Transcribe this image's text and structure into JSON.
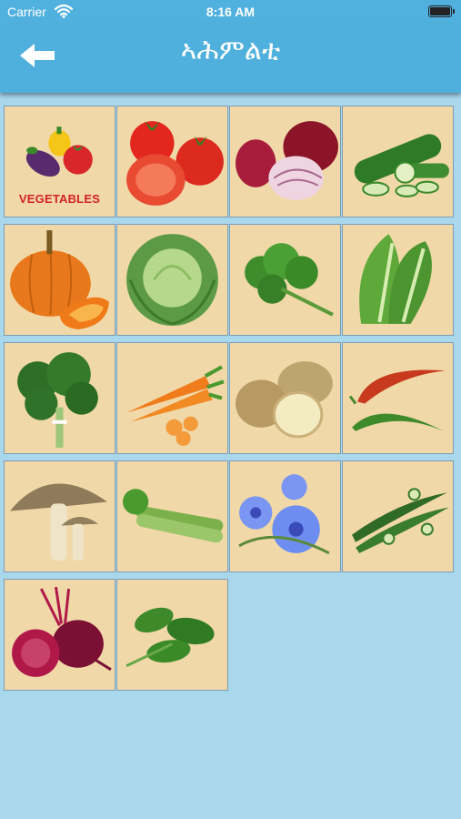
{
  "status_bar": {
    "carrier": "Carrier",
    "time": "8:16 AM"
  },
  "nav": {
    "title": "ኣሕምልቲ",
    "back_icon": "back-arrow-icon"
  },
  "grid": {
    "tiles": [
      {
        "name": "vegetables",
        "label": "VEGETABLES"
      },
      {
        "name": "tomato"
      },
      {
        "name": "onion"
      },
      {
        "name": "zucchini"
      },
      {
        "name": "pumpkin"
      },
      {
        "name": "cabbage"
      },
      {
        "name": "parsley"
      },
      {
        "name": "lettuce"
      },
      {
        "name": "kale"
      },
      {
        "name": "carrot"
      },
      {
        "name": "potato"
      },
      {
        "name": "chili-pepper"
      },
      {
        "name": "mushroom"
      },
      {
        "name": "celery"
      },
      {
        "name": "chicory-flower"
      },
      {
        "name": "okra"
      },
      {
        "name": "beetroot"
      },
      {
        "name": "spinach"
      }
    ]
  },
  "colors": {
    "background": "#a9d7ec",
    "navbar": "#4fb0dd",
    "tile": "#f0d8a8",
    "tile_border": "#7f9db4",
    "label": "#d4212b"
  }
}
